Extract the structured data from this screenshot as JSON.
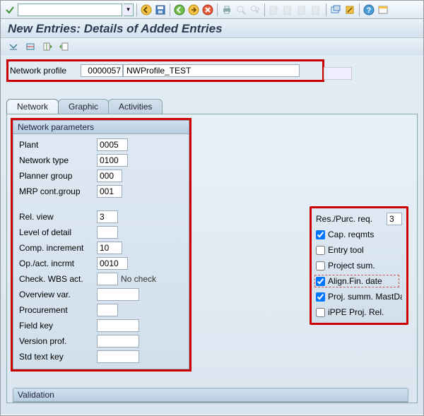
{
  "toolbar": {
    "command_value": "",
    "back_icon": "back",
    "save_icon": "save"
  },
  "page_title": "New Entries: Details of Added Entries",
  "profile": {
    "label": "Network profile",
    "number": "0000057",
    "name": "NWProfile_TEST"
  },
  "tabs": {
    "network": "Network",
    "graphic": "Graphic",
    "activities": "Activities"
  },
  "group_titles": {
    "network_params": "Network parameters",
    "validation": "Validation"
  },
  "network_params": {
    "plant": {
      "label": "Plant",
      "value": "0005"
    },
    "network_type": {
      "label": "Network type",
      "value": "0100"
    },
    "planner_group": {
      "label": "Planner group",
      "value": "000"
    },
    "mrp_cont_group": {
      "label": "MRP cont.group",
      "value": "001"
    },
    "rel_view": {
      "label": "Rel. view",
      "value": "3"
    },
    "level_of_detail": {
      "label": "Level of detail",
      "value": ""
    },
    "comp_increment": {
      "label": "Comp. increment",
      "value": "10"
    },
    "op_act_incrmt": {
      "label": "Op./act. incrmt",
      "value": "0010"
    },
    "check_wbs_act": {
      "label": "Check. WBS act.",
      "value": "",
      "text": "No check"
    },
    "overview_var": {
      "label": "Overview var.",
      "value": ""
    },
    "procurement": {
      "label": "Procurement",
      "value": ""
    },
    "field_key": {
      "label": "Field key",
      "value": ""
    },
    "version_prof": {
      "label": "Version prof.",
      "value": ""
    },
    "std_text_key": {
      "label": "Std text key",
      "value": ""
    }
  },
  "right_panel": {
    "res_purc_req": {
      "label": "Res./Purc. req.",
      "value": "3"
    },
    "cap_reqmts": {
      "label": "Cap. reqmts",
      "checked": true
    },
    "entry_tool": {
      "label": "Entry tool",
      "checked": false
    },
    "project_sum": {
      "label": "Project sum.",
      "checked": false
    },
    "align_fin_date": {
      "label": "Align.Fin. date",
      "checked": true
    },
    "proj_summ_mastda": {
      "label": "Proj. summ. MastDa",
      "checked": true
    },
    "ippe_proj_rel": {
      "label": "iPPE Proj. Rel.",
      "checked": false
    }
  }
}
